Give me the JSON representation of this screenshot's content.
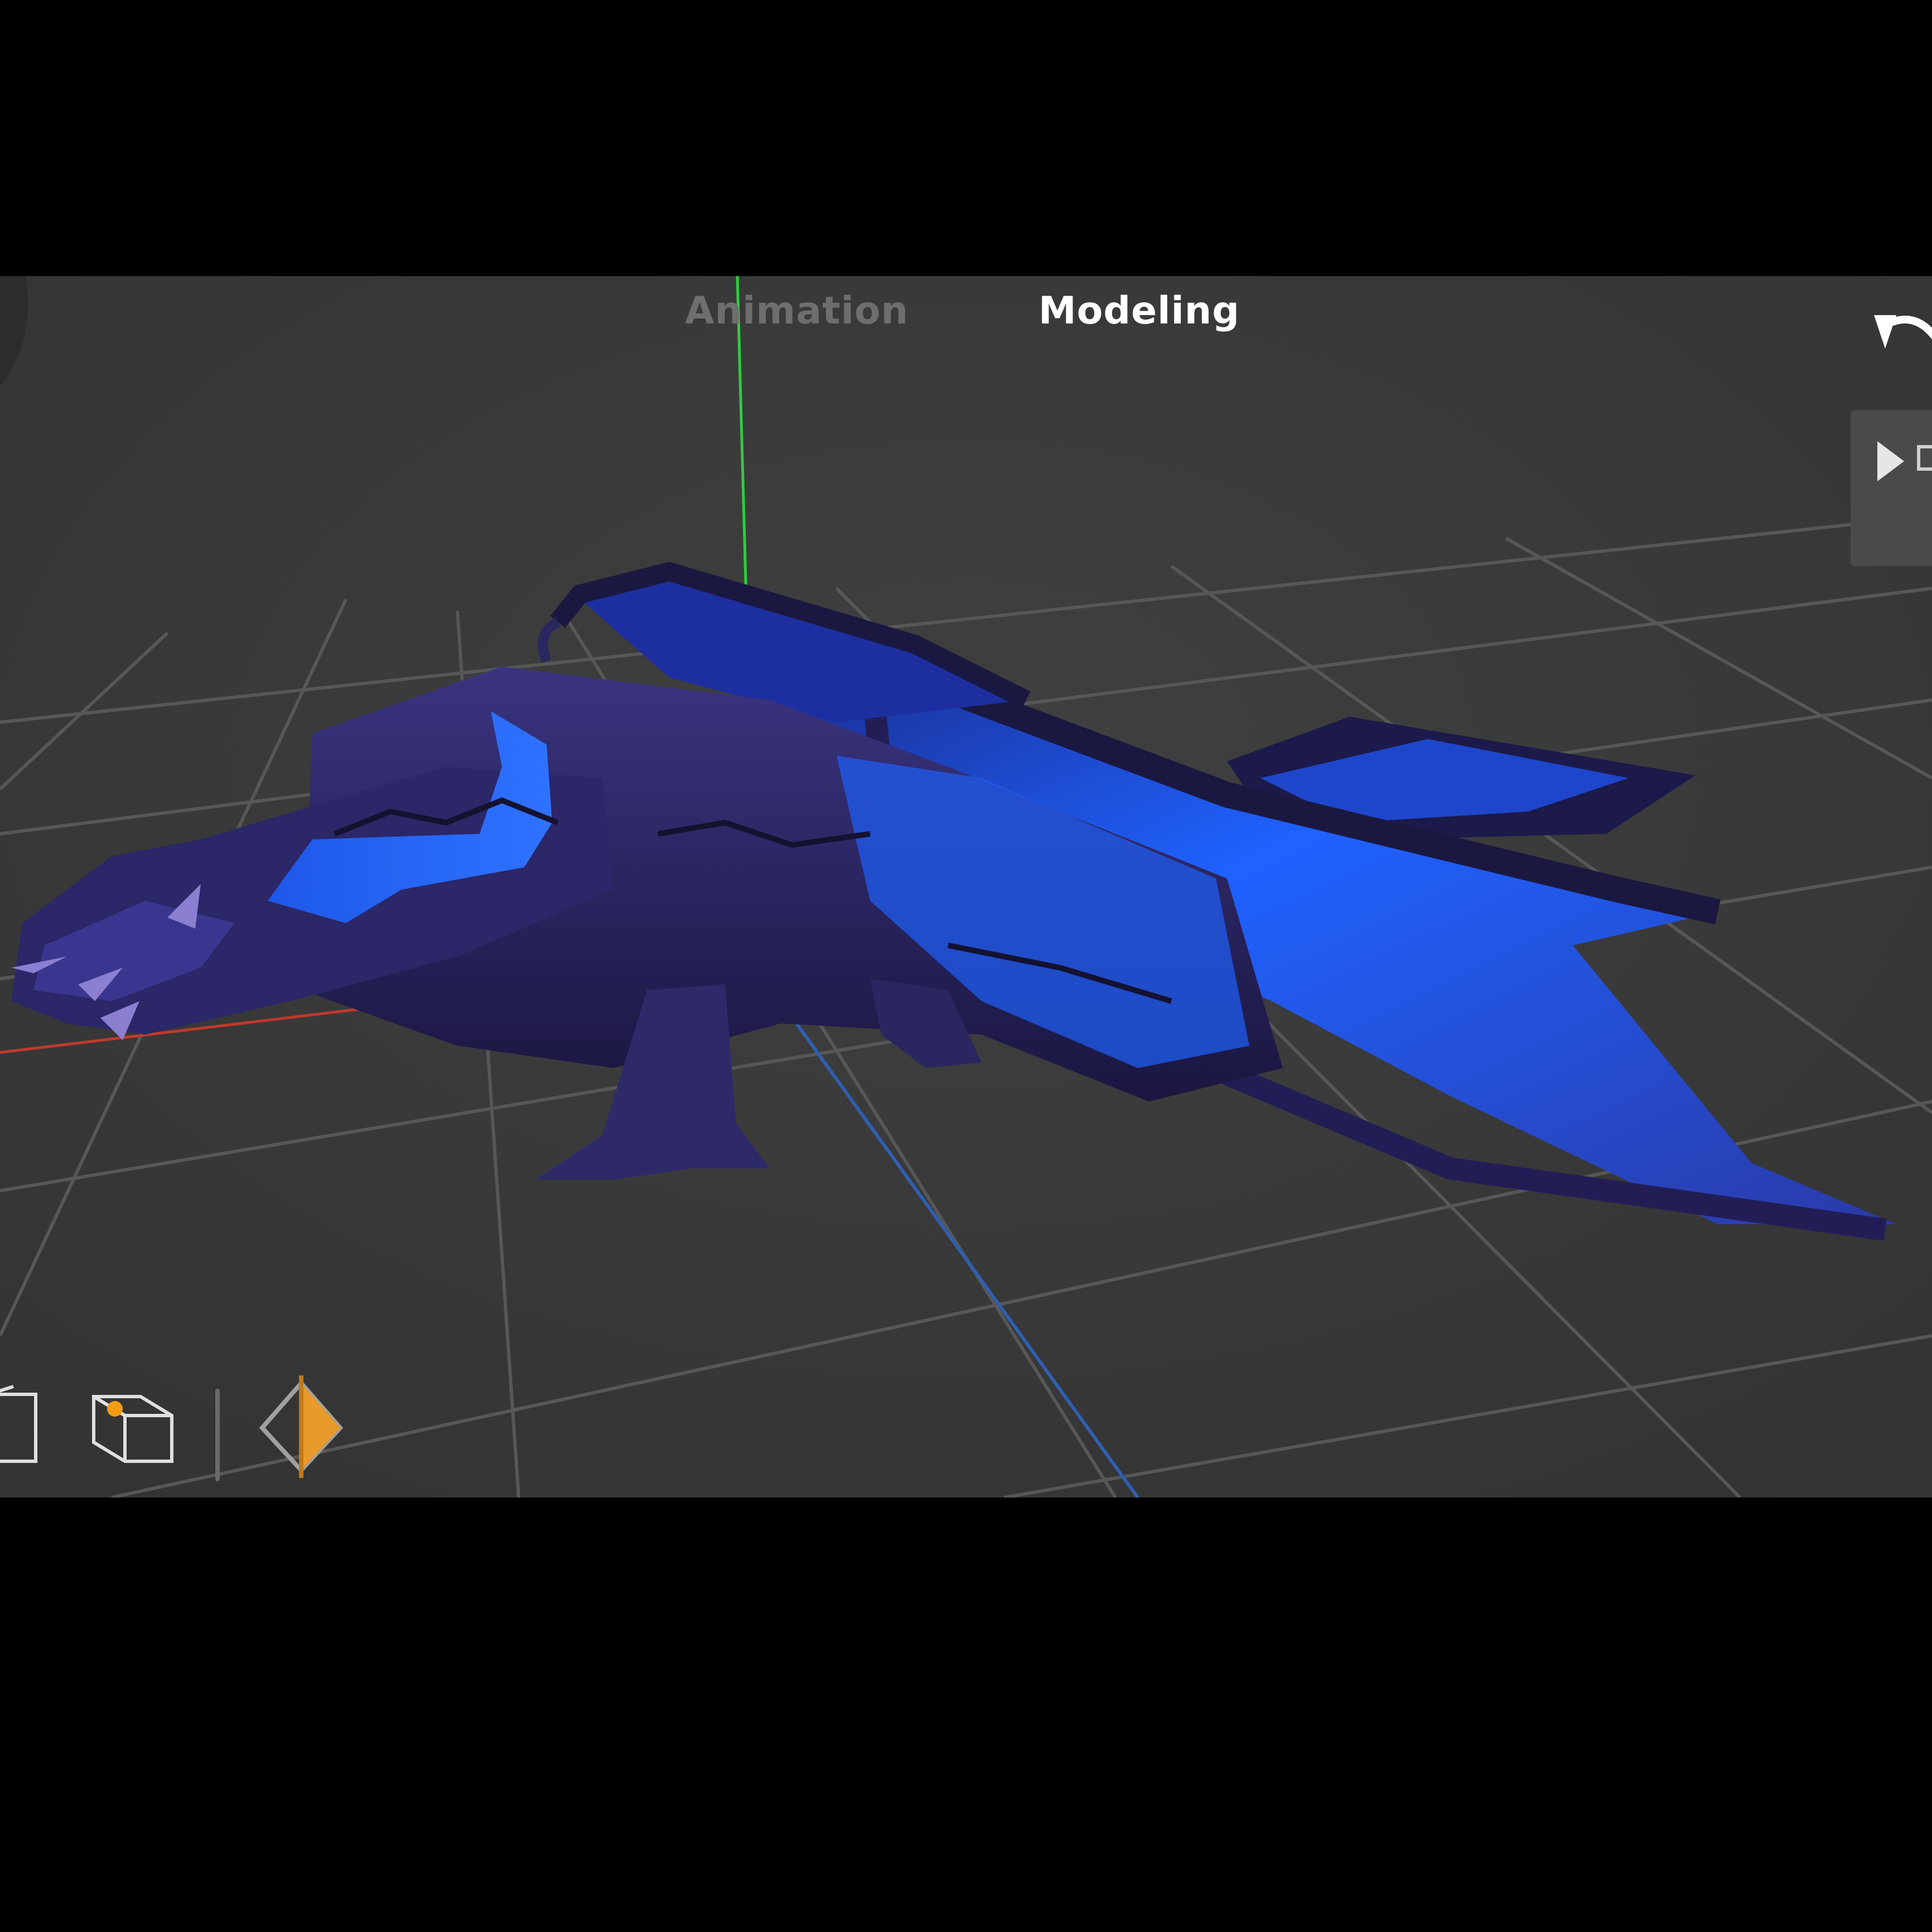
{
  "mode_tabs": {
    "animation": "Animation",
    "modeling": "Modeling",
    "active": "Modeling"
  },
  "colors": {
    "viewport_background": "#3a3a3a",
    "grid_line": "#555555",
    "axis_x": "#c0392b",
    "axis_y": "#2ecc40",
    "axis_z": "#2f5fb3",
    "tab_active": "#ffffff",
    "tab_inactive": "#6e6e6e",
    "keyframe_accent": "#e89a2a",
    "vertex_dot": "#f39c12",
    "model_dark": "#1c1a4a",
    "model_bright": "#1f62ff"
  },
  "icons": {
    "undo": "undo-icon",
    "play": "play-icon",
    "object_mode": "cube-icon",
    "vertex_mode": "cube-vertex-icon",
    "keyframe": "keyframe-diamond-icon"
  }
}
